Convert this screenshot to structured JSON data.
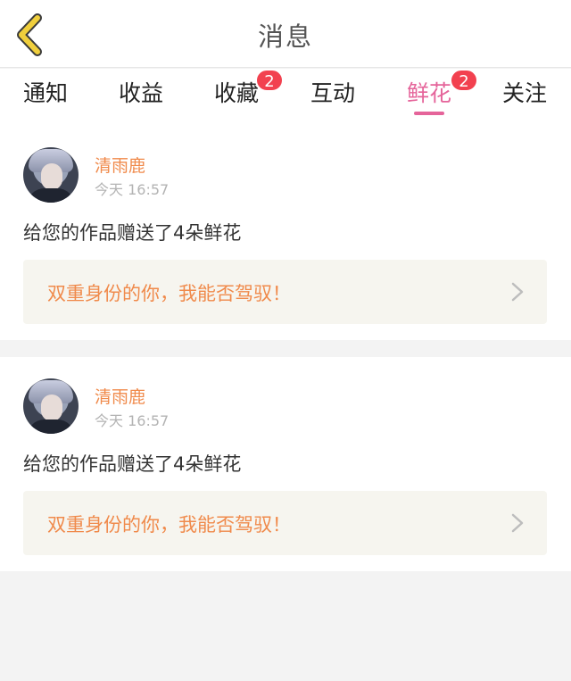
{
  "header": {
    "title": "消息"
  },
  "tabs": [
    {
      "label": "通知",
      "badge": ""
    },
    {
      "label": "收益",
      "badge": ""
    },
    {
      "label": "收藏",
      "badge": "2"
    },
    {
      "label": "互动",
      "badge": ""
    },
    {
      "label": "鲜花",
      "badge": "2",
      "active": true
    },
    {
      "label": "关注",
      "badge": ""
    }
  ],
  "messages": [
    {
      "username": "清雨鹿",
      "time": "今天 16:57",
      "text": "给您的作品赠送了4朵鲜花",
      "work_title": "双重身份的你，我能否驾驭！"
    },
    {
      "username": "清雨鹿",
      "time": "今天 16:57",
      "text": "给您的作品赠送了4朵鲜花",
      "work_title": "双重身份的你，我能否驾驭！"
    }
  ],
  "colors": {
    "accent_pink": "#e5649a",
    "badge_red": "#f2414f",
    "orange_text": "#f08a4b",
    "back_icon": "#f0cf3c"
  },
  "icons": {
    "back": "back-chevron-icon",
    "link": "chevron-right-icon"
  }
}
